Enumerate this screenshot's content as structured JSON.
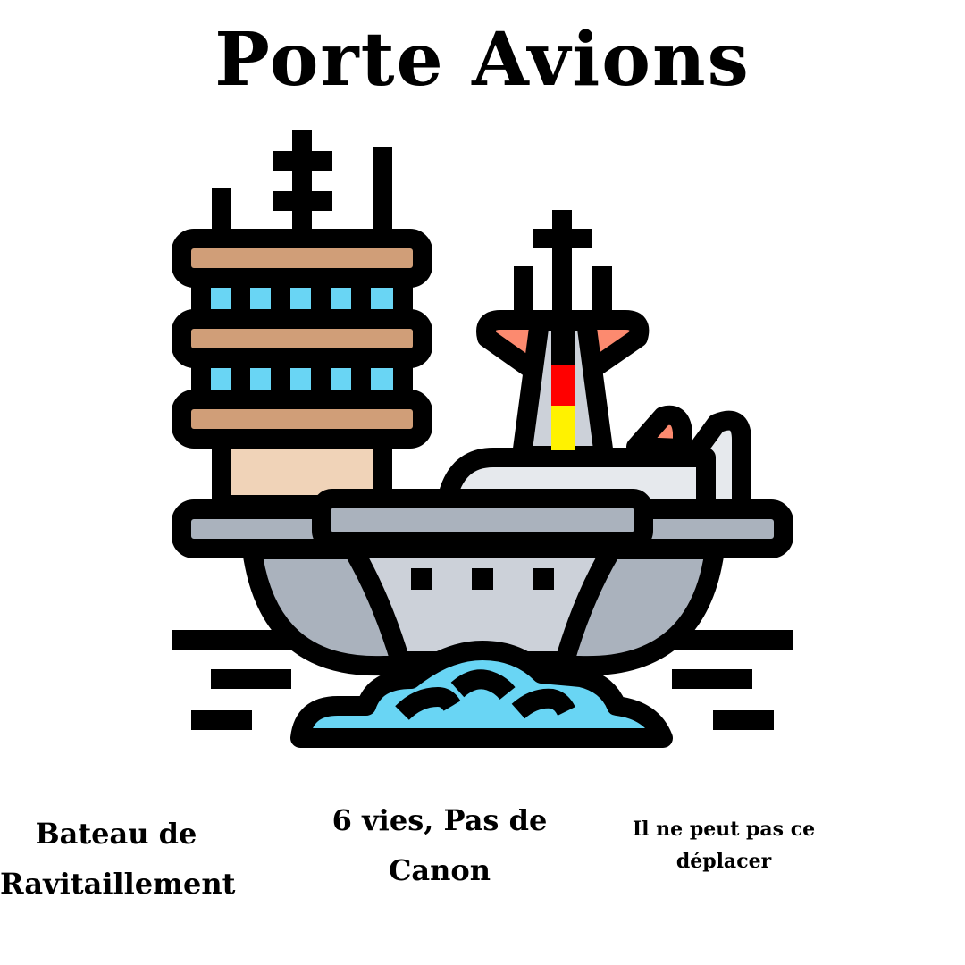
{
  "title": "Porte Avions",
  "captions": {
    "type": {
      "line1": "Bateau de",
      "line2": "Ravitaillement"
    },
    "stats": {
      "line1": "6 vies, Pas de",
      "line2": "Canon"
    },
    "movement": {
      "line1": "Il ne peut pas ce",
      "line2": "déplacer"
    }
  },
  "icon": {
    "name": "aircraft-carrier-icon"
  },
  "colors": {
    "outline": "#000000",
    "tower_stripe": "#D09E78",
    "window": "#69D5F4",
    "tower_base": "#F0D3B8",
    "hull": "#AAB2BD",
    "hull_center": "#CCD1D9",
    "plane": "#E6E9ED",
    "accent": "#FC8A6F",
    "flag_red": "#FF0000",
    "flag_yellow": "#FFF200",
    "water": "#69D5F4"
  }
}
